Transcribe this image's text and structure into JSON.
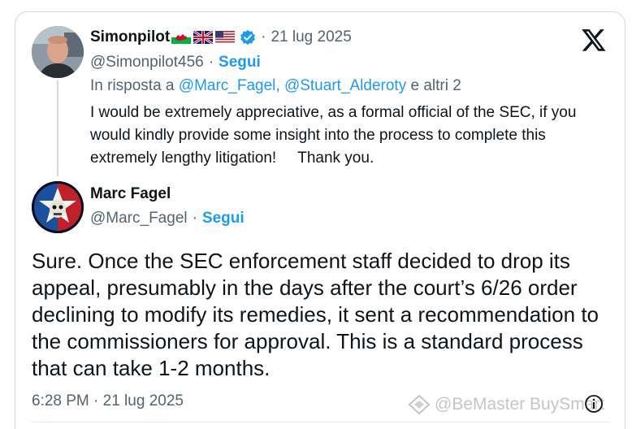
{
  "reply_tweet": {
    "display_name": "Simonpilot",
    "flags": [
      "wales-flag-icon",
      "uk-flag-icon",
      "us-flag-icon"
    ],
    "verified": true,
    "separator": "·",
    "date": "21 lug 2025",
    "handle": "@Simonpilot456",
    "handle_separator": "·",
    "follow_label": "Segui",
    "reply_prefix": "In risposta a ",
    "reply_mentions": "@Marc_Fagel, @Stuart_Alderoty",
    "reply_suffix": " e altri 2",
    "text": "I would be extremely appreciative, as a formal official of the SEC, if you would kindly provide some insight into the process to complete this extremely lengthy litigation!     Thank you."
  },
  "main_tweet": {
    "display_name": "Marc Fagel",
    "handle": "@Marc_Fagel",
    "handle_separator": "·",
    "follow_label": "Segui",
    "text": "Sure. Once the SEC enforcement staff decided to drop its appeal, presumably in the days after the court’s 6/26 order declining to modify its remedies, it sent a recommendation to the commissioners for approval. This is a standard process that can take 1-2 months.",
    "timestamp": "6:28 PM · 21 lug 2025"
  },
  "watermark": {
    "text": "@BeMaster BuySmart"
  },
  "colors": {
    "link": "#1d9bf0",
    "secondary_text": "#536471",
    "primary_text": "#0f1419",
    "border": "#cfd9de"
  }
}
